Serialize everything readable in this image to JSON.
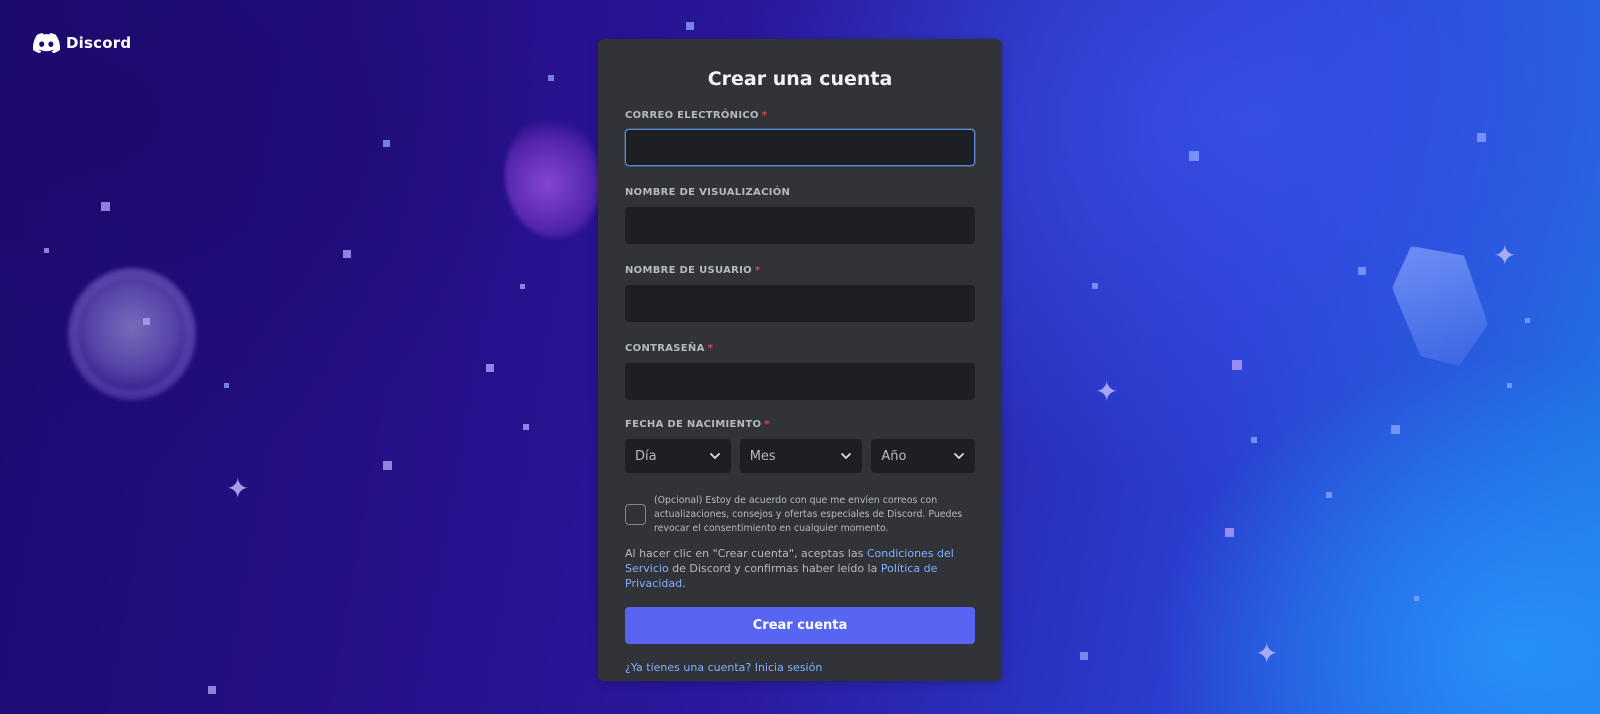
{
  "brand": {
    "name": "Discord"
  },
  "form": {
    "title": "Crear una cuenta",
    "email_label": "CORREO ELECTRÓNICO",
    "email_value": "",
    "display_name_label": "NOMBRE DE VISUALIZACIÓN",
    "display_name_value": "",
    "username_label": "NOMBRE DE USUARIO",
    "username_value": "",
    "password_label": "CONTRASEÑA",
    "password_value": "",
    "dob_label": "FECHA DE NACIMIENTO",
    "dob_day": "Día",
    "dob_month": "Mes",
    "dob_year": "Año",
    "required_mark": "*",
    "consent_text": "(Opcional) Estoy de acuerdo con que me envíen correos con actualizaciones, consejos y ofertas especiales de Discord. Puedes revocar el consentimiento en cualquier momento.",
    "terms_pre": "Al hacer clic en \"Crear cuenta\", aceptas las ",
    "terms_link": "Condiciones del Servicio",
    "terms_mid": " de Discord y confirmas haber leído la ",
    "privacy_link": "Política de Privacidad",
    "terms_end": ".",
    "submit_label": "Crear cuenta",
    "login_link": "¿Ya tienes una cuenta? Inicia sesión"
  },
  "colors": {
    "card": "#313338",
    "input": "#1e1f22",
    "accent": "#5865f2",
    "required": "#f23f43",
    "link": "#7fb2ff"
  }
}
